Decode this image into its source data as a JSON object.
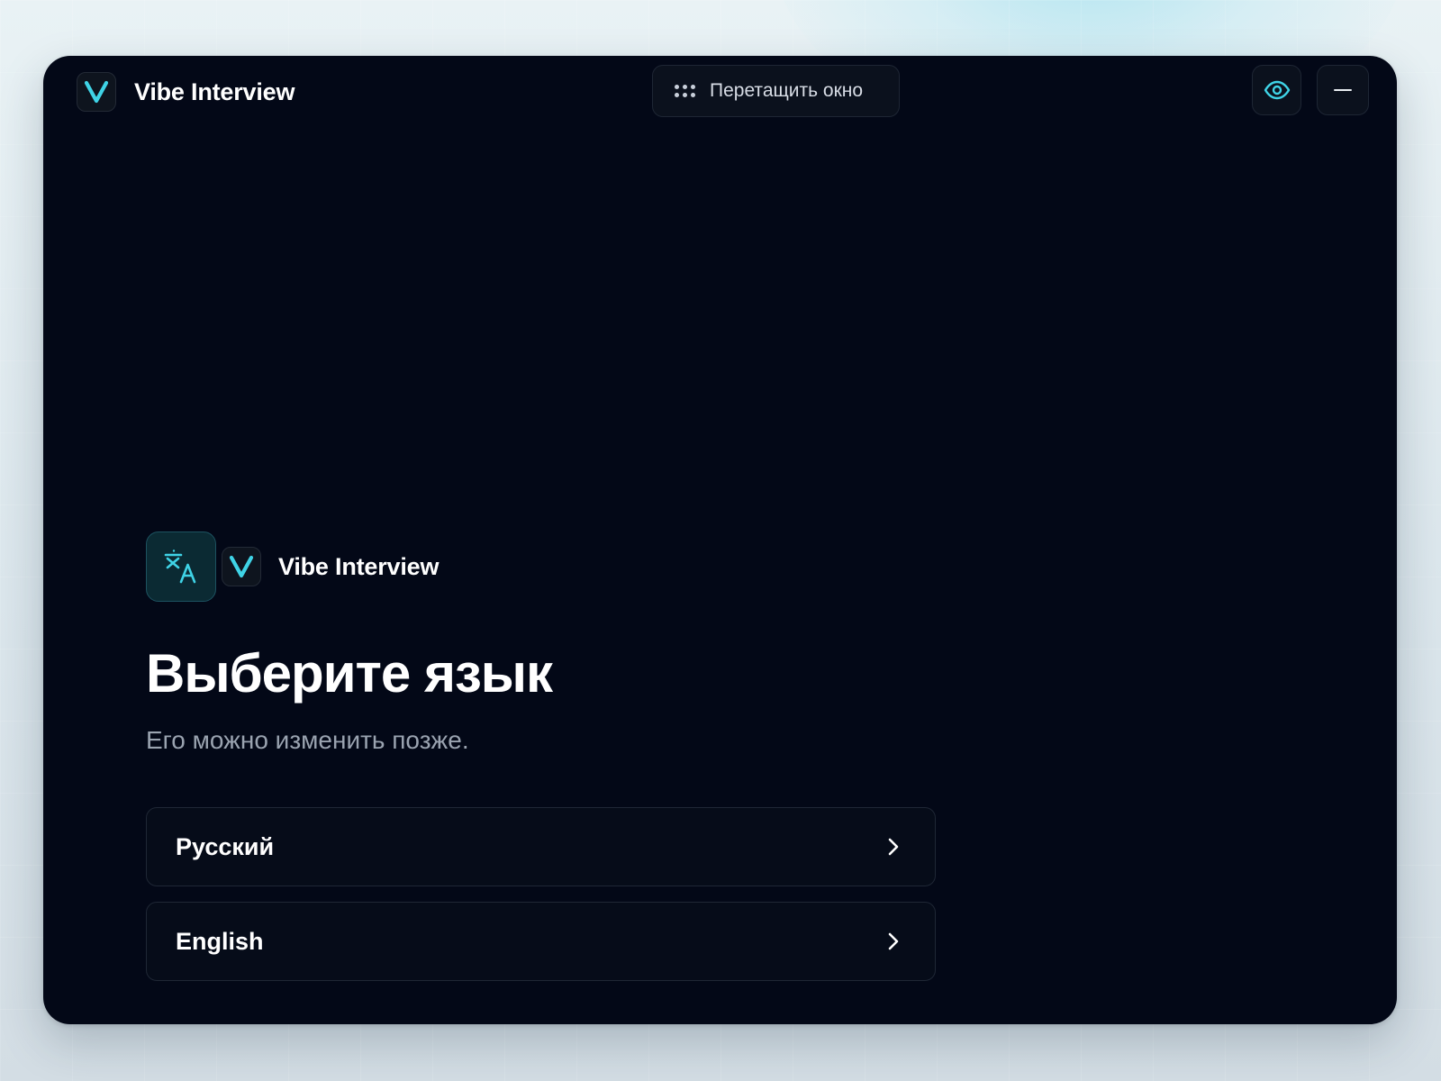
{
  "app": {
    "title": "Vibe Interview",
    "accent_color": "#3fd3e6",
    "logo_icon": "v-logo-icon"
  },
  "titlebar": {
    "drag_label": "Перетащить окно",
    "drag_icon": "grip-dots-icon",
    "visibility_icon": "eye-icon",
    "minimize_icon": "minimize-icon"
  },
  "onboarding": {
    "brand_name": "Vibe Interview",
    "translate_icon": "translate-icon",
    "title": "Выберите язык",
    "subtitle": "Его можно изменить позже.",
    "languages": [
      {
        "label": "Русский",
        "icon": "chevron-right-icon"
      },
      {
        "label": "English",
        "icon": "chevron-right-icon"
      }
    ]
  }
}
